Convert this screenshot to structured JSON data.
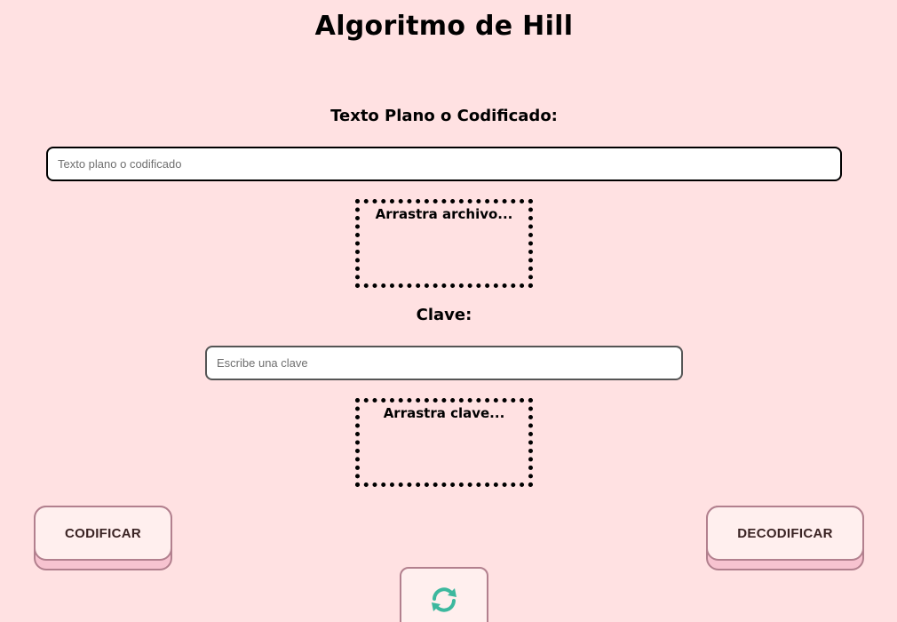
{
  "page": {
    "title": "Algoritmo de Hill"
  },
  "text_section": {
    "label": "Texto Plano o Codificado:",
    "input_placeholder": "Texto plano o codificado",
    "input_value": "",
    "dropzone_label": "Arrastra archivo..."
  },
  "key_section": {
    "label": "Clave:",
    "input_placeholder": "Escribe una clave",
    "input_value": "",
    "dropzone_label": "Arrastra clave..."
  },
  "actions": {
    "encode_label": "CODIFICAR",
    "decode_label": "DECODIFICAR",
    "refresh_icon": "refresh-icon"
  },
  "colors": {
    "background": "#ffe1e2",
    "button_face": "#ffefee",
    "button_shadow": "#f7c3d0",
    "button_border": "#b2808e",
    "refresh_icon": "#3cb89e"
  }
}
